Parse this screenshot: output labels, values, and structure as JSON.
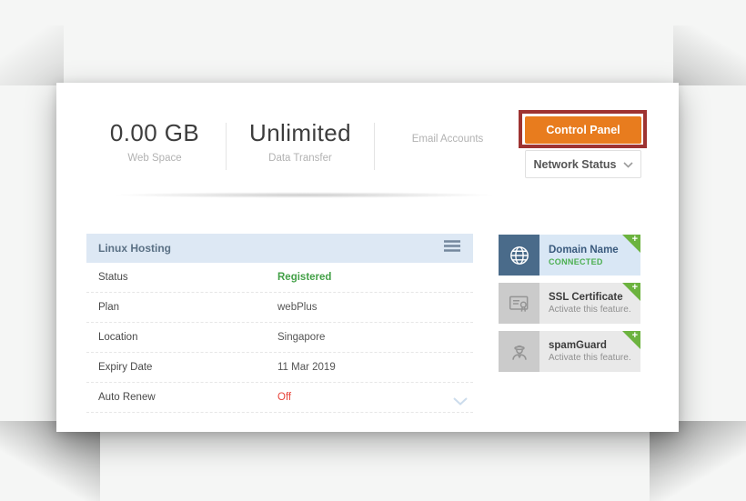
{
  "stats": [
    {
      "value": "0.00 GB",
      "label": "Web Space"
    },
    {
      "value": "Unlimited",
      "label": "Data Transfer"
    },
    {
      "label": "Email Accounts"
    }
  ],
  "actions": {
    "control_panel_label": "Control Panel",
    "network_status_label": "Network Status"
  },
  "hosting": {
    "title": "Linux Hosting",
    "rows": [
      {
        "label": "Status",
        "value": "Registered"
      },
      {
        "label": "Plan",
        "value": "webPlus"
      },
      {
        "label": "Location",
        "value": "Singapore"
      },
      {
        "label": "Expiry Date",
        "value": "11 Mar 2019"
      },
      {
        "label": "Auto Renew",
        "value": "Off"
      }
    ]
  },
  "addons": [
    {
      "title": "Domain Name",
      "subtitle": "CONNECTED",
      "badge": "+"
    },
    {
      "title": "SSL Certificate",
      "subtitle": "Activate this feature.",
      "badge": "+"
    },
    {
      "title": "spamGuard",
      "subtitle": "Activate this feature.",
      "badge": "+"
    }
  ],
  "colors": {
    "accent_orange": "#e87c1e",
    "annotation_red": "#9e3331",
    "status_green": "#43a047",
    "auto_renew_red": "#e8443a",
    "addon_plus_green": "#6cb33f",
    "table_header_bg": "#dde8f4",
    "domain_tile_blue": "#4a6b8a",
    "connected_green": "#4caf50"
  }
}
